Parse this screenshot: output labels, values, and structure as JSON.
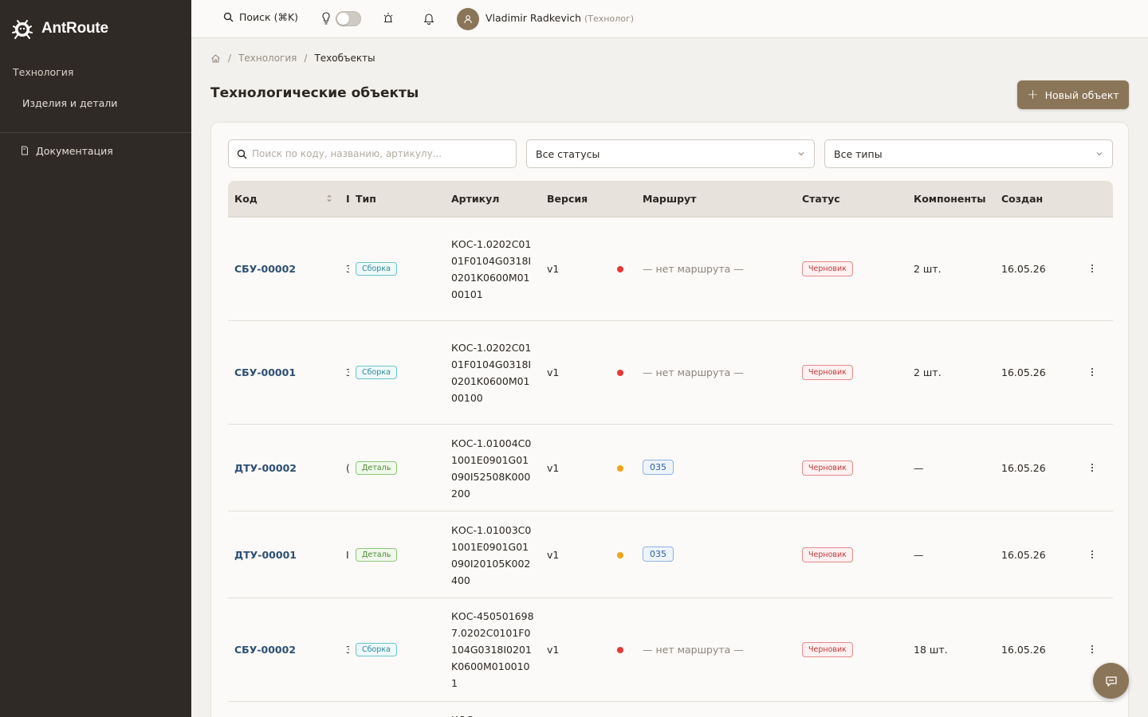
{
  "app": {
    "name": "AntRoute"
  },
  "sidebar": {
    "section": "Технология",
    "items": [
      {
        "label": "Изделия и детали"
      }
    ],
    "doc": {
      "label": "Документация",
      "icon": "document-icon"
    }
  },
  "topbar": {
    "search_label": "Поиск (⌘K)",
    "user_name": "Vladimir Radkevich",
    "user_role": "(Технолог)",
    "theme_toggle_on": false
  },
  "breadcrumb": {
    "home_icon": "home-icon",
    "level1": "Технология",
    "level2": "Техобъекты"
  },
  "page": {
    "title": "Технологические объекты",
    "new_button": "Новый объект"
  },
  "filters": {
    "search_placeholder": "Поиск по коду, названию, артикулу...",
    "status_select": "Все статусы",
    "type_select": "Все типы"
  },
  "table": {
    "columns": [
      "Код",
      "Тип",
      "Артикул",
      "Версия",
      "Маршрут",
      "Статус",
      "Компоненты",
      "Создан"
    ],
    "rows": [
      {
        "code": "СБУ-00002",
        "cut": "З",
        "type": "Сборка",
        "type_kind": "sborka",
        "artikul": "КОС-1.0202С0101F0104G0318I0201K0600M0100101",
        "version": "v1",
        "dot": "#e53935",
        "route": "— нет маршрута —",
        "route_kind": "none",
        "status": "Черновик",
        "components": "2 шт.",
        "created": "16.05.26"
      },
      {
        "code": "СБУ-00001",
        "cut": "З",
        "type": "Сборка",
        "type_kind": "sborka",
        "artikul": "КОС-1.0202С0101F0104G0318I0201K0600M0100100",
        "version": "v1",
        "dot": "#e53935",
        "route": "— нет маршрута —",
        "route_kind": "none",
        "status": "Черновик",
        "components": "2 шт.",
        "created": "16.05.26"
      },
      {
        "code": "ДТУ-00002",
        "cut": "(",
        "type": "Деталь",
        "type_kind": "detal",
        "artikul": "КОС-1.01004С01001E0901G01090I52508K000200",
        "version": "v1",
        "dot": "#f0a21c",
        "route": "035",
        "route_kind": "badge",
        "status": "Черновик",
        "components": "—",
        "created": "16.05.26"
      },
      {
        "code": "ДТУ-00001",
        "cut": "I",
        "type": "Деталь",
        "type_kind": "detal",
        "artikul": "КОС-1.01003С01001E0901G01090I20105K002400",
        "version": "v1",
        "dot": "#f0a21c",
        "route": "035",
        "route_kind": "badge",
        "status": "Черновик",
        "components": "—",
        "created": "16.05.26"
      },
      {
        "code": "СБУ-00002",
        "cut": "З",
        "type": "Сборка",
        "type_kind": "sborka",
        "artikul": "КОС-4505016987.0202С0101F0104G0318I0201K0600M0100101",
        "version": "v1",
        "dot": "#e53935",
        "route": "— нет маршрута —",
        "route_kind": "none",
        "status": "Черновик",
        "components": "18 шт.",
        "created": "16.05.26"
      },
      {
        "code": "",
        "cut": "",
        "type": "",
        "type_kind": "",
        "artikul": "КОС-",
        "version": "",
        "dot": "",
        "route": "",
        "route_kind": "",
        "status": "",
        "components": "",
        "created": ""
      }
    ]
  },
  "colors": {
    "sidebar_bg": "#2f2a25",
    "accent": "#8b7558",
    "code_link": "#2d4f75"
  }
}
